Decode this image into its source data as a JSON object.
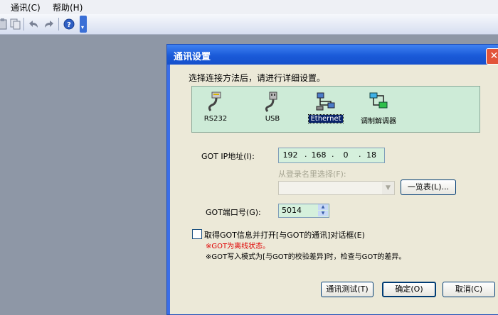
{
  "menu": [
    {
      "label": "通讯(C)"
    },
    {
      "label": "帮助(H)"
    }
  ],
  "toolbar": {
    "icons": [
      "paste-icon",
      "copy-icon",
      "undo-icon",
      "redo-icon",
      "help-icon"
    ]
  },
  "dialog": {
    "title": "通讯设置",
    "close_glyph": "✕",
    "prompt": "选择连接方法后，请进行详细设置。",
    "methods": [
      {
        "label": "RS232",
        "icon": "serial-cable-icon",
        "selected": false
      },
      {
        "label": "USB",
        "icon": "usb-plug-icon",
        "selected": false
      },
      {
        "label": "Ethernet",
        "icon": "network-icon",
        "selected": true
      },
      {
        "label": "调制解调器",
        "icon": "modem-icon",
        "selected": false
      }
    ],
    "ip_label": "GOT IP地址(I):",
    "ip_octets": [
      "192",
      "168",
      "0",
      "18"
    ],
    "login_name_label": "从登录名里选择(F):",
    "login_combo_value": "",
    "list_button": "一览表(L)...",
    "port_label": "GOT端口号(G):",
    "port_value": "5014",
    "checkbox_label": "取得GOT信息并打开[与GOT的通讯]对话框(E)",
    "checkbox_checked": false,
    "warning": "※GOT为离线状态。",
    "note": "※GOT写入模式为[与GOT的校验差异]时，检查与GOT的差异。",
    "test_button": "通讯测试(T)",
    "ok_button": "确定(O)",
    "cancel_button": "取消(C)"
  },
  "colors": {
    "panel_green": "#cdebd7",
    "field_green": "#d5f0dc",
    "titlebar_blue": "#1a5ad8",
    "warning_red": "#e00000",
    "selection_navy": "#0a246a"
  }
}
